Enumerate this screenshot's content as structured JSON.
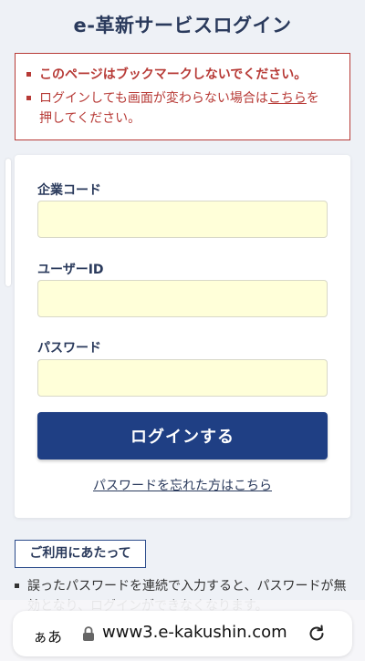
{
  "page": {
    "title": "e-革新サービスログイン"
  },
  "notice": {
    "line1": "このページはブックマークしないでください。",
    "line2_prefix": "ログインしても画面が変わらない場合は",
    "line2_link": "こちら",
    "line2_suffix": "を",
    "line3": "押してください。"
  },
  "form": {
    "company_code_label": "企業コード",
    "company_code_value": "",
    "user_id_label": "ユーザーID",
    "user_id_value": "",
    "password_label": "パスワード",
    "password_value": "",
    "login_button": "ログインする",
    "forgot_link": "パスワードを忘れた方はこちら"
  },
  "info": {
    "heading": "ご利用にあたって",
    "text": "誤ったパスワードを連続で入力すると、パスワードが無効となり、ログインができなくなります。"
  },
  "browser": {
    "aa_label": "ぁあ",
    "url": "www3.e-kakushin.com",
    "lock_icon": "lock-icon",
    "reload_icon": "reload-icon"
  },
  "colors": {
    "accent": "#1f3f84",
    "warning": "#b73a36",
    "input_bg": "#ffffd9"
  }
}
